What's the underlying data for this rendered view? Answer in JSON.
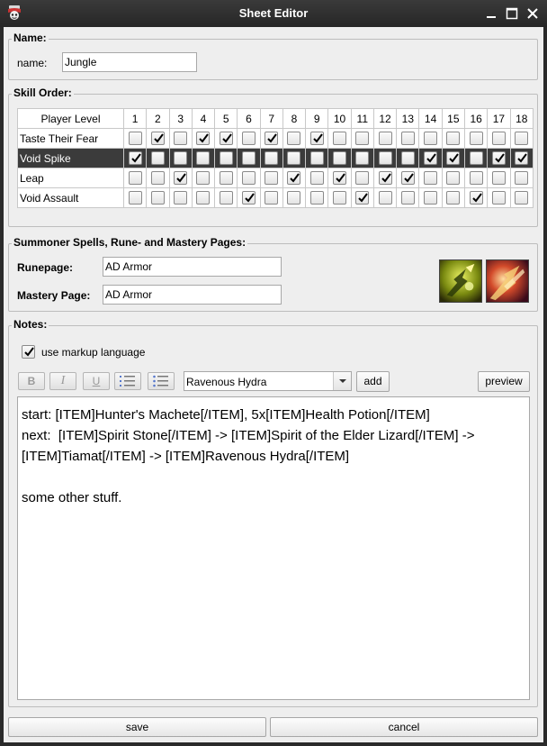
{
  "window": {
    "title": "Sheet Editor"
  },
  "name_group": {
    "title": "Name:",
    "label": "name:",
    "value": "Jungle"
  },
  "skill_order": {
    "title": "Skill Order:",
    "header_label": "Player Level",
    "levels": [
      "1",
      "2",
      "3",
      "4",
      "5",
      "6",
      "7",
      "8",
      "9",
      "10",
      "11",
      "12",
      "13",
      "14",
      "15",
      "16",
      "17",
      "18"
    ],
    "rows": [
      {
        "name": "Taste Their Fear",
        "selected": false,
        "checked": [
          2,
          4,
          5,
          7,
          9
        ]
      },
      {
        "name": "Void Spike",
        "selected": true,
        "checked": [
          1,
          14,
          15,
          17,
          18
        ]
      },
      {
        "name": "Leap",
        "selected": false,
        "checked": [
          3,
          8,
          10,
          12,
          13
        ]
      },
      {
        "name": "Void Assault",
        "selected": false,
        "checked": [
          6,
          11,
          16
        ]
      }
    ]
  },
  "spells_group": {
    "title": "Summoner Spells, Rune- and Mastery Pages:",
    "runepage_label": "Runepage:",
    "runepage_value": "AD Armor",
    "mastery_label": "Mastery Page:",
    "mastery_value": "AD Armor"
  },
  "notes": {
    "title": "Notes:",
    "markup_label": "use markup language",
    "markup_checked": true,
    "format_buttons": {
      "bold": "B",
      "italic": "I",
      "underline": "U"
    },
    "item_select": "Ravenous Hydra",
    "add_label": "add",
    "preview_label": "preview",
    "lines": [
      "start: [ITEM]Hunter's Machete[/ITEM], 5x[ITEM]Health Potion[/ITEM]",
      "next:  [ITEM]Spirit Stone[/ITEM] -> [ITEM]Spirit of the Elder Lizard[/ITEM] ->",
      "[ITEM]Tiamat[/ITEM] -> [ITEM]Ravenous Hydra[/ITEM]",
      "",
      "some other stuff."
    ]
  },
  "footer": {
    "save_label": "save",
    "cancel_label": "cancel"
  },
  "colors": {
    "selected_row": "#3b3b3b",
    "title_bar": "#2b2b2b"
  }
}
